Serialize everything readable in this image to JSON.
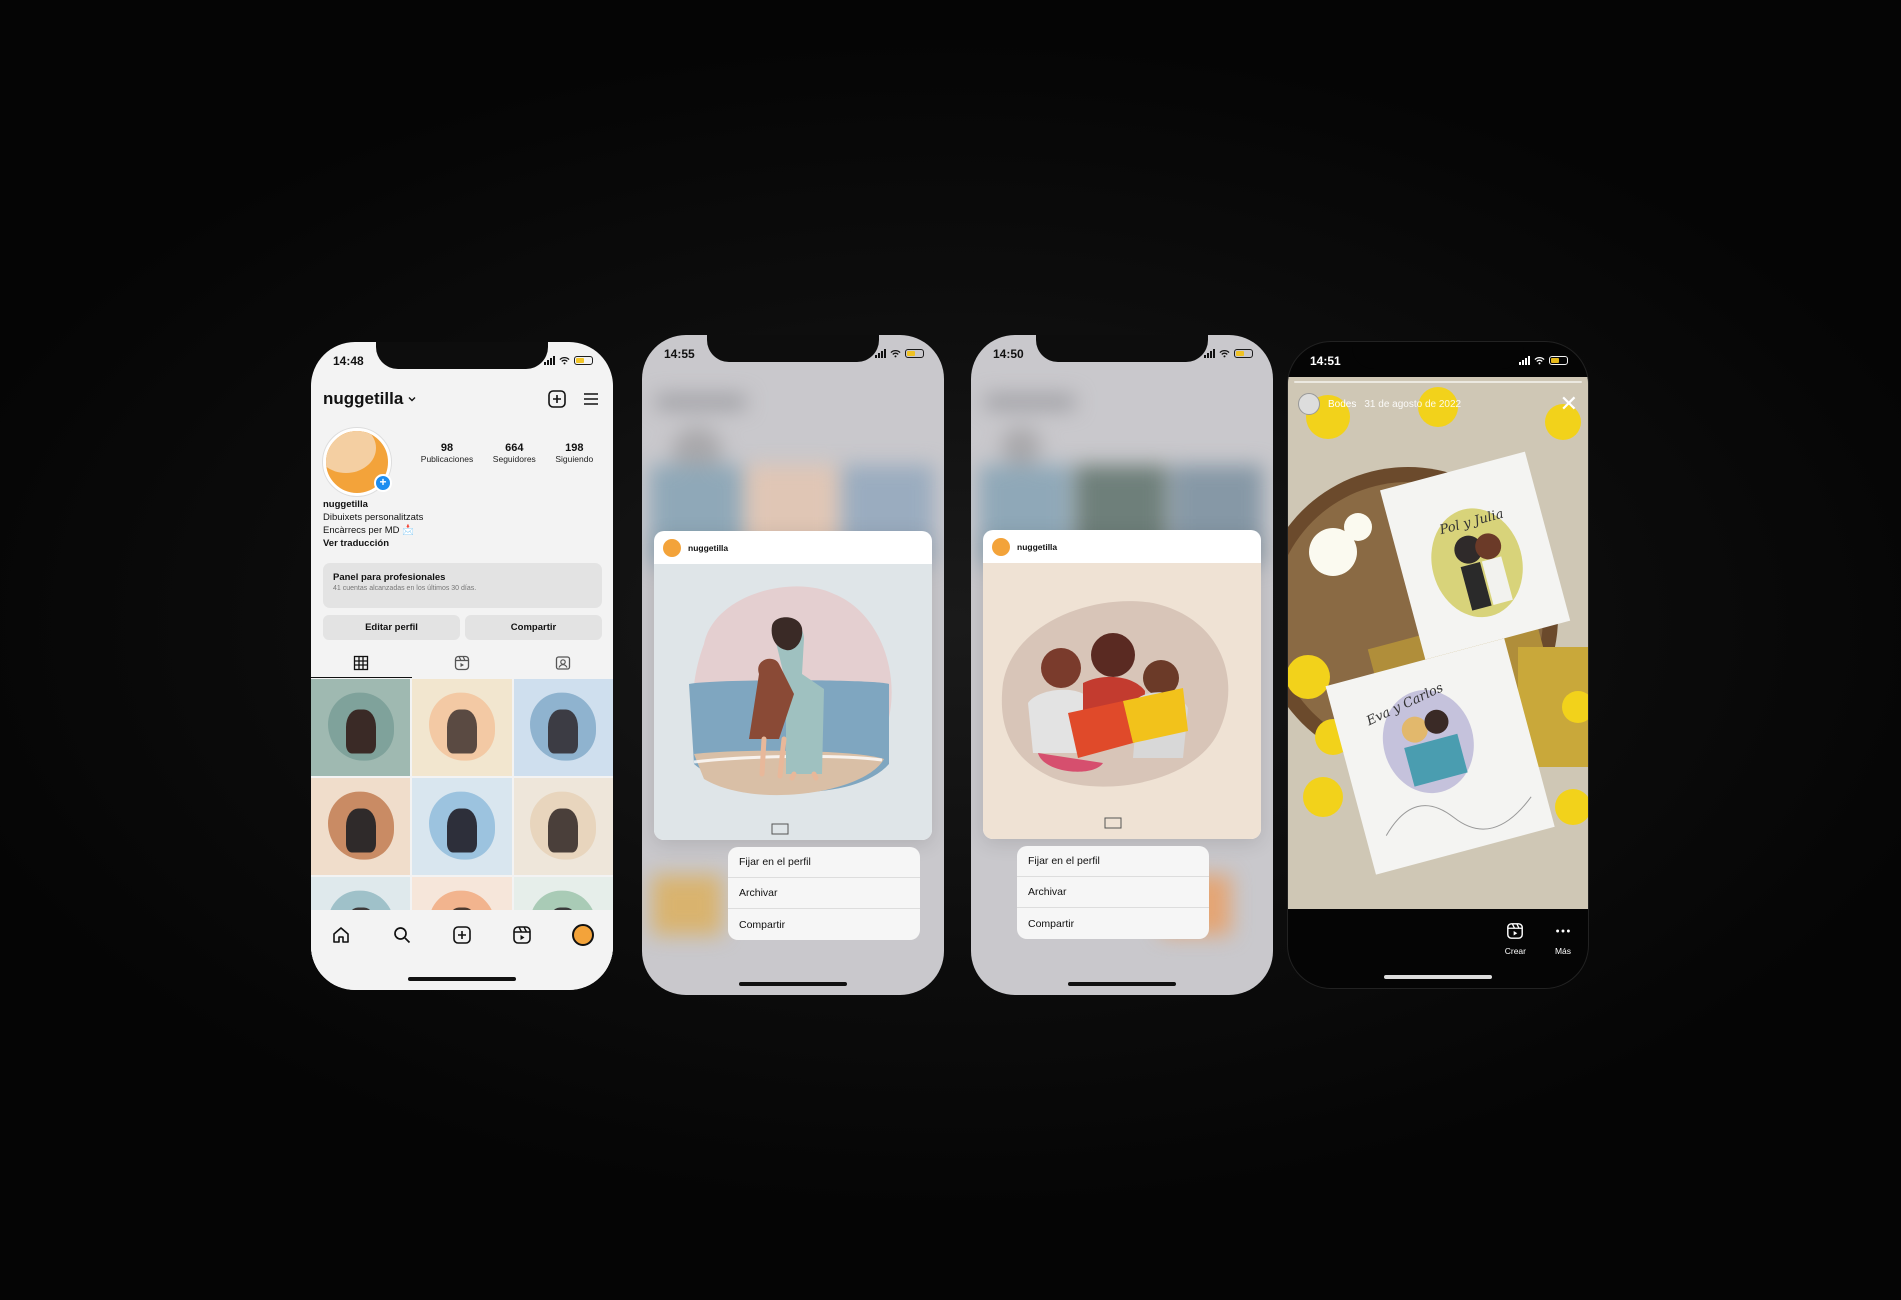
{
  "phone1": {
    "time": "14:48",
    "username": "nuggetilla",
    "stats": [
      {
        "value": "98",
        "label": "Publicaciones"
      },
      {
        "value": "664",
        "label": "Seguidores"
      },
      {
        "value": "198",
        "label": "Siguiendo"
      }
    ],
    "bio": {
      "name": "nuggetilla",
      "line1": "Dibuixets personalitzats",
      "line2": "Encàrrecs per MD 📩",
      "translate": "Ver traducción"
    },
    "panel": {
      "title": "Panel para profesionales",
      "subtitle": "41 cuentas alcanzadas en los últimos 30 días."
    },
    "edit_button": "Editar perfil",
    "share_button": "Compartir",
    "grid_colors": [
      "#9fb9b1",
      "#f2e6cf",
      "#cfdfee",
      "#f0ddcb",
      "#d9e6ef",
      "#eee6da",
      "#dfe9ec",
      "#f6e6da",
      "#e6eeea"
    ],
    "blob_colors": [
      "#7fa29b",
      "#f3c9a4",
      "#8fb3cf",
      "#c98b64",
      "#9cc3df",
      "#e8d5bd",
      "#9fc1c9",
      "#f2b48e",
      "#a9cbb6"
    ],
    "figure_colors": [
      "#3a2a26",
      "#5a4a42",
      "#3c3c44",
      "#2f2a2a",
      "#2d2f3a",
      "#4a3f3a",
      "#3d3a3a",
      "#4c3a30",
      "#3a3a3a"
    ]
  },
  "phone2": {
    "time": "14:55",
    "username": "nuggetilla",
    "menu": [
      "Fijar en el perfil",
      "Archivar",
      "Compartir"
    ]
  },
  "phone3": {
    "time": "14:50",
    "username": "nuggetilla",
    "menu": [
      "Fijar en el perfil",
      "Archivar",
      "Compartir"
    ]
  },
  "phone4": {
    "time": "14:51",
    "highlight": "Bodes",
    "date": "31 de agosto de 2022",
    "card_top_text": "Pol y Julia",
    "card_bottom_text": "Eva y Carlos",
    "action_create": "Crear",
    "action_more": "Más"
  },
  "colors": {
    "accent": "#f3a33a",
    "blue_badge": "#1d8df0",
    "menu_bg": "#f6f6f6"
  }
}
